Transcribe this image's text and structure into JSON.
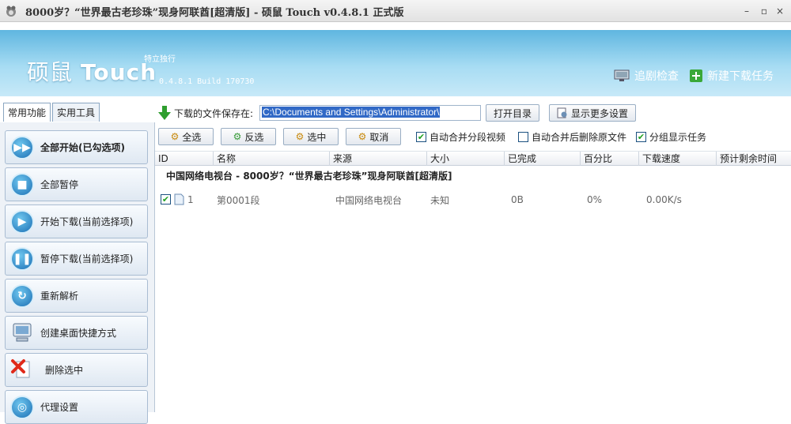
{
  "window": {
    "title": "8000岁？“世界最古老珍珠”现身阿联酋[超清版] - 硕鼠 Touch v0.4.8.1 正式版",
    "minimize": "–",
    "maximize": "▫",
    "close": "×"
  },
  "banner": {
    "logo_zh": "硕鼠",
    "logo_en": "Touch",
    "tagline": "特立独行",
    "version": "0.4.8.1 Build 170730",
    "track_label": "追剧检查",
    "new_task_label": "新建下载任务"
  },
  "tabs": [
    "常用功能",
    "实用工具"
  ],
  "sidebar": {
    "items": [
      {
        "label": "全部开始(已勾选项)",
        "icon": "fast-forward-icon"
      },
      {
        "label": "全部暂停",
        "icon": "stop-icon"
      },
      {
        "label": "开始下载(当前选择项)",
        "icon": "play-icon"
      },
      {
        "label": "暂停下载(当前选择项)",
        "icon": "pause-icon"
      },
      {
        "label": "重新解析",
        "icon": "refresh-icon"
      },
      {
        "label": "创建桌面快捷方式",
        "icon": "computer-icon"
      },
      {
        "label": "删除选中",
        "icon": "delete-icon"
      },
      {
        "label": "代理设置",
        "icon": "globe-icon"
      }
    ]
  },
  "save": {
    "label": "下载的文件保存在:",
    "path": "C:\\Documents and Settings\\Administrator\\",
    "open_dir": "打开目录",
    "more_settings": "显示更多设置"
  },
  "toolbar": {
    "select_all": "全选",
    "invert": "反选",
    "select": "选中",
    "cancel": "取消",
    "auto_merge": "自动合并分段视频",
    "auto_merge_delete": "自动合并后删除原文件",
    "group_display": "分组显示任务",
    "auto_merge_checked": true,
    "auto_merge_delete_checked": false,
    "group_display_checked": true
  },
  "table": {
    "columns": [
      "ID",
      "名称",
      "来源",
      "大小",
      "已完成",
      "百分比",
      "下载速度",
      "预计剩余时间"
    ],
    "group_title": "中国网络电视台 - 8000岁？“世界最古老珍珠”现身阿联酋[超清版]",
    "rows": [
      {
        "id": "1",
        "name": "第0001段",
        "source": "中国网络电视台",
        "size": "未知",
        "done": "0B",
        "percent": "0%",
        "speed": "0.00K/s",
        "remaining": "",
        "checked": true
      }
    ]
  },
  "colors": {
    "banner_top": "#5fb6e0",
    "accent": "#3169c6",
    "sidebar_bg": "#eef2f7"
  }
}
